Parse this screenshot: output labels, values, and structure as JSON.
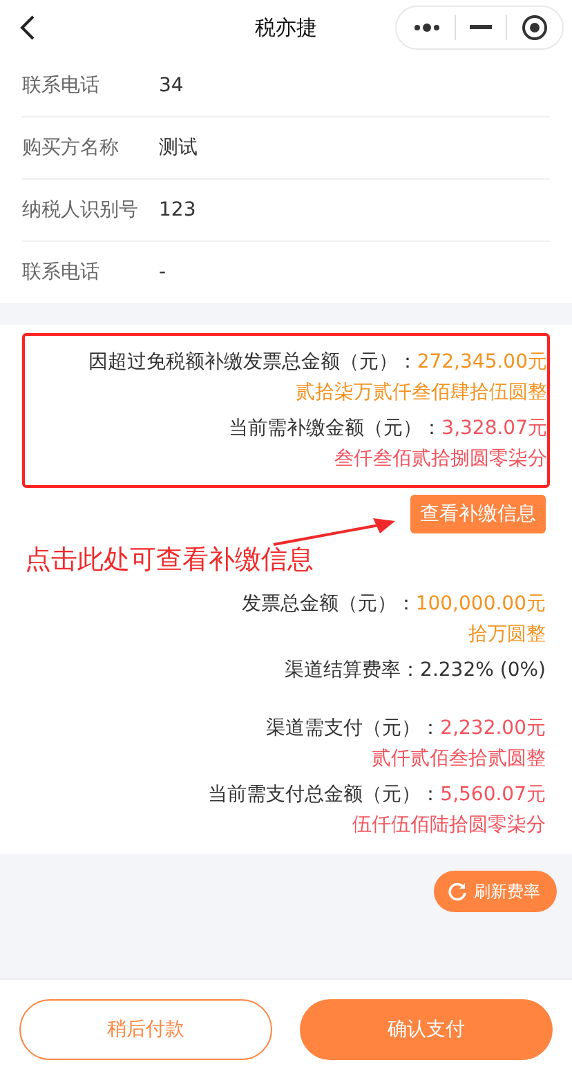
{
  "title": "税亦捷",
  "info_rows": [
    {
      "label": "联系电话",
      "value": "34"
    },
    {
      "label": "购买方名称",
      "value": "测试"
    },
    {
      "label": "纳税人识别号",
      "value": "123"
    },
    {
      "label": "联系电话",
      "value": "-"
    }
  ],
  "highlight": {
    "items": [
      {
        "label": "因超过免税额补缴发票总金额（元）：",
        "amount": "272,345.00元",
        "words": "贰拾柒万贰仟叁佰肆拾伍圆整",
        "color": "#f5921e"
      },
      {
        "label": "当前需补缴金额（元）：",
        "amount": "3,328.07元",
        "words": "叁仟叁佰贰拾捌圆零柒分",
        "color": "#f4525c"
      }
    ],
    "button": "查看补缴信息"
  },
  "annotation": "点击此处可查看补缴信息",
  "summary": [
    {
      "kind": "amount",
      "label": "发票总金额（元）：",
      "amount": "100,000.00元",
      "words": "拾万圆整",
      "color": "#f5921e"
    },
    {
      "kind": "rate",
      "text": "渠道结算费率：2.232% (0%)"
    },
    {
      "kind": "amount",
      "label": "渠道需支付（元）：",
      "amount": "2,232.00元",
      "words": "贰仟贰佰叁拾贰圆整",
      "color": "#f4525c"
    },
    {
      "kind": "amount",
      "label": "当前需支付总金额（元）：",
      "amount": "5,560.07元",
      "words": "伍仟伍佰陆拾圆零柒分",
      "color": "#f4525c"
    }
  ],
  "refresh_button": "刷新费率",
  "footer_buttons": [
    {
      "label": "稍后付款",
      "kind": "outline"
    },
    {
      "label": "确认支付",
      "kind": "primary"
    }
  ]
}
